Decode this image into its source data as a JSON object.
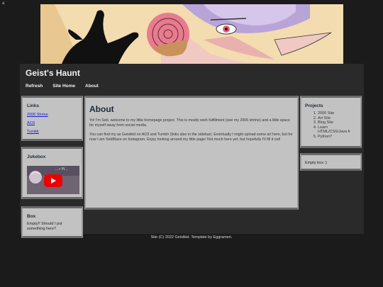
{
  "corner_char": "a",
  "site": {
    "title": "Geist's Haunt"
  },
  "nav": [
    {
      "label": "Refresh"
    },
    {
      "label": "Site Home"
    },
    {
      "label": "About"
    }
  ],
  "links_box": {
    "title": "Links",
    "items": [
      {
        "label": "2006 Shrine"
      },
      {
        "label": "AO3"
      },
      {
        "label": "Tumblr"
      }
    ]
  },
  "jukebox": {
    "title": "Jukebox",
    "video_title": "... r Pi..."
  },
  "box": {
    "title": "Box",
    "text": "Empty!! Should I put something here?"
  },
  "main": {
    "title": "About",
    "p1": "Yo! I'm Seb, welcome to my little homepage project. This is mostly wish fulfillment (see my 2006 shrine) and a little space for myself away from social media.",
    "p2": "You can find my as Geistkid on AO3 and Tumblr (links also in the sidebar). Eventually I might upload some art here, but for now I am SebBlaze on Instagram. Enjoy looking around my little page! Not much here yet, but hopefully I'll fill it out!"
  },
  "projects": {
    "title": "Projects",
    "items": [
      "2006 Site",
      "Art Site",
      "Blog Site",
      "Learn HTML/CSS/Java fr",
      "Python?"
    ]
  },
  "empty_box": {
    "text": "Empty box :)"
  },
  "footer": {
    "text": "Site (C) 2022 Geistkid. Template by Eggramen."
  },
  "colors": {
    "background": "#1b1b1b",
    "panel": "#2a2a2a",
    "box": "#c2c2c2",
    "link": "#1a1ad8",
    "heading": "#1e2a38"
  }
}
